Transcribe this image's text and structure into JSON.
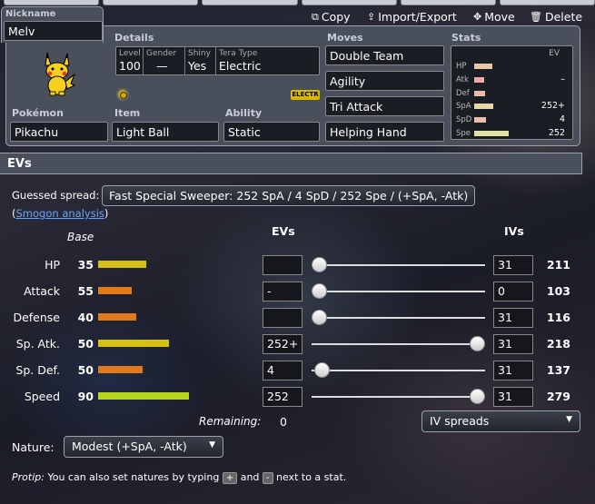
{
  "nickname": {
    "label": "Nickname",
    "value": "Melv"
  },
  "actions": {
    "copy": "Copy",
    "import_export": "Import/Export",
    "move": "Move",
    "delete": "Delete"
  },
  "details": {
    "label": "Details",
    "level_key": "Level",
    "level": "100",
    "gender_key": "Gender",
    "gender": "—",
    "shiny_key": "Shiny",
    "shiny": "Yes",
    "tera_key": "Tera Type",
    "tera": "Electric",
    "tera_badge": "ELECTR"
  },
  "pokemon": {
    "label": "Pokémon",
    "value": "Pikachu"
  },
  "item": {
    "label": "Item",
    "value": "Light Ball"
  },
  "ability": {
    "label": "Ability",
    "value": "Static"
  },
  "moves": {
    "label": "Moves",
    "list": [
      "Double Team",
      "Agility",
      "Tri Attack",
      "Helping Hand"
    ]
  },
  "stats_summary": {
    "label": "Stats",
    "ev_header": "EV",
    "rows": [
      {
        "name": "HP",
        "ev": ""
      },
      {
        "name": "Atk",
        "ev": "–"
      },
      {
        "name": "Def",
        "ev": ""
      },
      {
        "name": "SpA",
        "ev": "252+"
      },
      {
        "name": "SpD",
        "ev": "4"
      },
      {
        "name": "Spe",
        "ev": "252"
      }
    ]
  },
  "evs_section": {
    "title": "EVs",
    "guessed_label": "Guessed spread:",
    "guessed_value": "Fast Special Sweeper: 252 SpA / 4 SpD / 252 Spe / (+SpA, -Atk)",
    "smogon_open": "(",
    "smogon_link": "Smogon analysis",
    "smogon_close": ")",
    "col_base": "Base",
    "col_evs": "EVs",
    "col_ivs": "IVs",
    "rows": [
      {
        "label": "HP",
        "base": "35",
        "ev": "",
        "iv": "31",
        "total": "211",
        "bar_color": "#d6c016",
        "bar_width": 53,
        "knob_pos": 0
      },
      {
        "label": "Attack",
        "base": "55",
        "ev": "-",
        "iv": "0",
        "total": "103",
        "bar_color": "#e07a1a",
        "bar_width": 37,
        "knob_pos": 0
      },
      {
        "label": "Defense",
        "base": "40",
        "ev": "",
        "iv": "31",
        "total": "116",
        "bar_color": "#e07a1a",
        "bar_width": 42,
        "knob_pos": 0
      },
      {
        "label": "Sp. Atk.",
        "base": "50",
        "ev": "252+",
        "iv": "31",
        "total": "218",
        "bar_color": "#d6c016",
        "bar_width": 78,
        "knob_pos": 1
      },
      {
        "label": "Sp. Def.",
        "base": "50",
        "ev": "4",
        "iv": "31",
        "total": "137",
        "bar_color": "#e07a1a",
        "bar_width": 49,
        "knob_pos": 0.02
      },
      {
        "label": "Speed",
        "base": "90",
        "ev": "252",
        "iv": "31",
        "total": "279",
        "bar_color": "#b5d41c",
        "bar_width": 100,
        "knob_pos": 1
      }
    ],
    "remaining_label": "Remaining:",
    "remaining_value": "0",
    "iv_spreads": "IV spreads",
    "nature_label": "Nature:",
    "nature_value": "Modest (+SpA, -Atk)",
    "protip_label": "Protip:",
    "protip_text_1": "You can also set natures by typing",
    "protip_key_plus": "+",
    "protip_and": "and",
    "protip_key_minus": "-",
    "protip_text_2": "next to a stat."
  }
}
